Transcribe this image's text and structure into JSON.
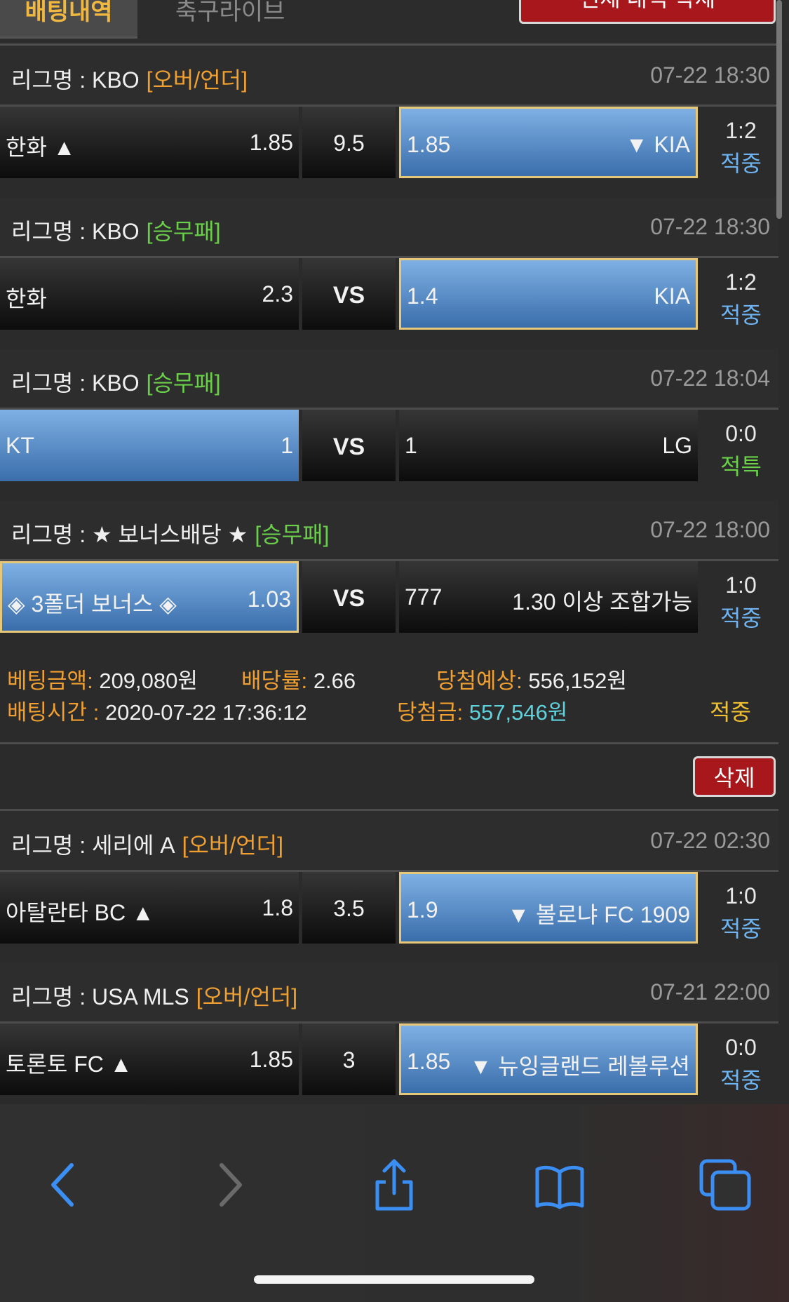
{
  "tabs": {
    "active": "배팅내역",
    "inactive": "축구라이브"
  },
  "delete_all_label": "전체 내역 삭제",
  "games": [
    {
      "league_label": "리그명 : ",
      "league": "KBO",
      "type": "[오버/언더]",
      "time": "07-22 18:30",
      "home": "한화 ▲",
      "home_odds": "1.85",
      "mid": "9.5",
      "away_odds": "1.85",
      "away": "▼ KIA",
      "score": "1:2",
      "status": "적중"
    },
    {
      "league_label": "리그명 : ",
      "league": "KBO",
      "type": "[승무패]",
      "time": "07-22 18:30",
      "home": "한화",
      "home_odds": "2.3",
      "mid": "VS",
      "away_odds": "1.4",
      "away": "KIA",
      "score": "1:2",
      "status": "적중"
    },
    {
      "league_label": "리그명 : ",
      "league": "KBO",
      "type": "[승무패]",
      "time": "07-22 18:04",
      "home": "KT",
      "home_odds": "1",
      "mid": "VS",
      "away_odds": "1",
      "away": "LG",
      "score": "0:0",
      "status": "적특"
    },
    {
      "league_label": "리그명 : ",
      "league": "★ 보너스배당 ★",
      "type": "[승무패]",
      "time": "07-22 18:00",
      "home": "◈ 3폴더 보너스 ◈",
      "home_odds": "1.03",
      "mid": "VS",
      "away_odds": "777",
      "away": "1.30 이상 조합가능",
      "score": "1:0",
      "status": "적중"
    },
    {
      "league_label": "리그명 : ",
      "league": "세리에 A",
      "type": "[오버/언더]",
      "time": "07-22 02:30",
      "home": "아탈란타 BC ▲",
      "home_odds": "1.8",
      "mid": "3.5",
      "away_odds": "1.9",
      "away": "▼ 볼로냐 FC 1909",
      "score": "1:0",
      "status": "적중"
    },
    {
      "league_label": "리그명 : ",
      "league": "USA MLS",
      "type": "[오버/언더]",
      "time": "07-21 22:00",
      "home": "토론토 FC ▲",
      "home_odds": "1.85",
      "mid": "3",
      "away_odds": "1.85",
      "away": "▼ 뉴잉글랜드 레볼루션",
      "score": "0:0",
      "status": "적중"
    }
  ],
  "summary": {
    "bet_amount_label": "베팅금액:",
    "bet_amount": "209,080원",
    "odds_label": "배당률:",
    "odds": "2.66",
    "expected_label": "당첨예상:",
    "expected": "556,152원",
    "bet_time_label": "배팅시간 :",
    "bet_time": "2020-07-22 17:36:12",
    "won_label": "당첨금:",
    "won": "557,546원",
    "status": "적중"
  },
  "delete_label": "삭제",
  "browser_toolbar": {
    "icons": [
      "back-icon",
      "forward-icon",
      "share-icon",
      "bookmarks-icon",
      "tabs-icon"
    ],
    "accent": "#3b8ef3"
  }
}
